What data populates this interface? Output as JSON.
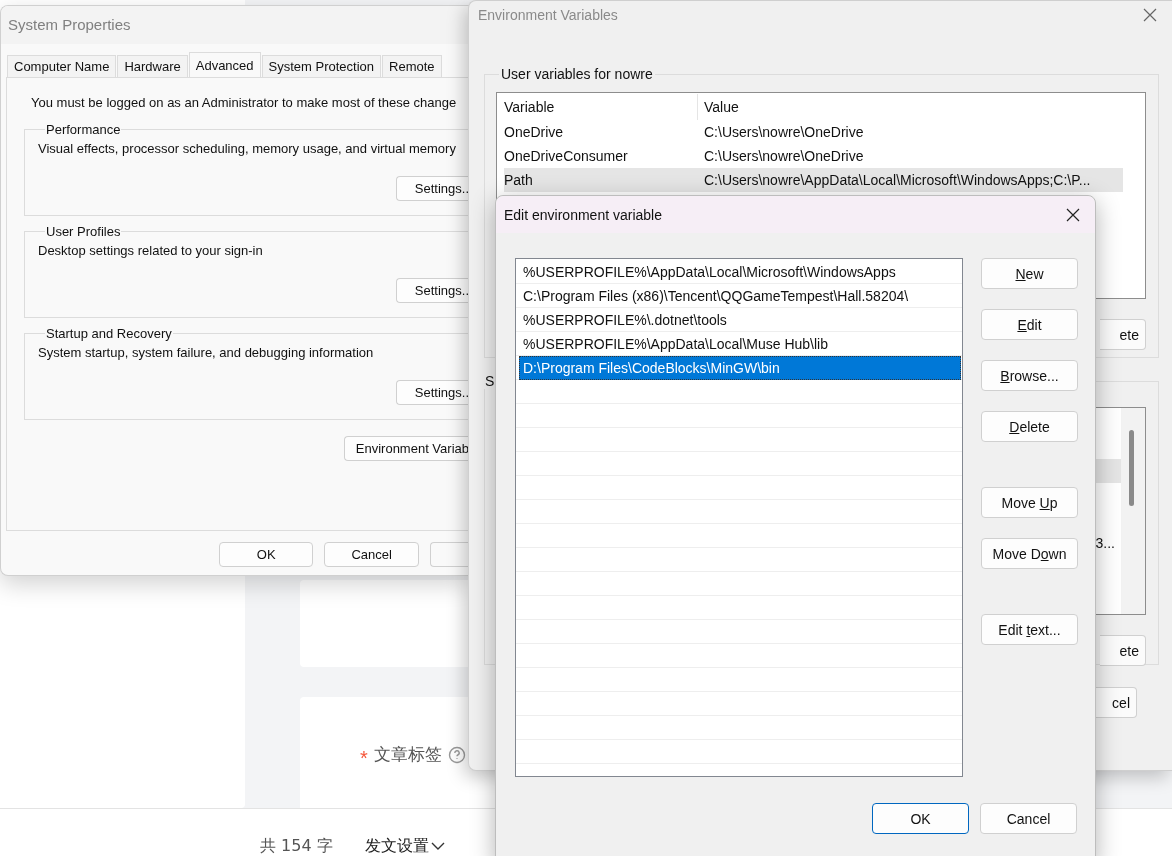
{
  "page": {
    "tag_field": {
      "required_mark": "*",
      "label": "文章标签"
    },
    "char_count": "共 154 字",
    "settings_menu": "发文设置"
  },
  "system_properties": {
    "title": "System Properties",
    "tabs": [
      {
        "label": "Computer Name",
        "selected": false
      },
      {
        "label": "Hardware",
        "selected": false
      },
      {
        "label": "Advanced",
        "selected": true
      },
      {
        "label": "System Protection",
        "selected": false
      },
      {
        "label": "Remote",
        "selected": false
      }
    ],
    "notice": "You must be logged on as an Administrator to make most of these change",
    "groups": [
      {
        "legend": "Performance",
        "description": "Visual effects, processor scheduling, memory usage, and virtual memory",
        "button": "Settings.."
      },
      {
        "legend": "User Profiles",
        "description": "Desktop settings related to your sign-in",
        "button": "Settings.."
      },
      {
        "legend": "Startup and Recovery",
        "description": "System startup, system failure, and debugging information",
        "button": "Settings.."
      }
    ],
    "env_button": "Environment Variab",
    "buttons": [
      "OK",
      "Cancel"
    ]
  },
  "environment_variables": {
    "title": "Environment Variables",
    "user_group": {
      "legend": "User variables for nowre",
      "columns": [
        "Variable",
        "Value"
      ],
      "rows": [
        {
          "variable": "OneDrive",
          "value": "C:\\Users\\nowre\\OneDrive",
          "selected": false
        },
        {
          "variable": "OneDriveConsumer",
          "value": "C:\\Users\\nowre\\OneDrive",
          "selected": false
        },
        {
          "variable": "Path",
          "value": "C:\\Users\\nowre\\AppData\\Local\\Microsoft\\WindowsApps;C:\\P...",
          "selected": true
        }
      ],
      "button_fragment": "ete"
    },
    "system_group": {
      "legend_fragment": "S",
      "row_fragment": "3...",
      "button_fragment": "ete"
    },
    "cancel_fragment": "cel"
  },
  "edit_dialog": {
    "title": "Edit environment variable",
    "entries": [
      {
        "text": "%USERPROFILE%\\AppData\\Local\\Microsoft\\WindowsApps",
        "selected": false
      },
      {
        "text": "C:\\Program Files (x86)\\Tencent\\QQGameTempest\\Hall.58204\\",
        "selected": false
      },
      {
        "text": "%USERPROFILE%\\.dotnet\\tools",
        "selected": false
      },
      {
        "text": "%USERPROFILE%\\AppData\\Local\\Muse Hub\\lib",
        "selected": false
      },
      {
        "text": "D:\\Program Files\\CodeBlocks\\MinGW\\bin",
        "selected": true
      }
    ],
    "side_button_groups": [
      [
        {
          "key": "N",
          "post": "ew"
        },
        {
          "key": "E",
          "post": "dit"
        },
        {
          "key": "B",
          "post": "rowse..."
        },
        {
          "key": "D",
          "post": "elete"
        }
      ],
      [
        {
          "pre": "Move ",
          "key": "U",
          "post": "p"
        },
        {
          "pre": "Move D",
          "key": "o",
          "post": "wn"
        }
      ],
      [
        {
          "pre": "Edit ",
          "key": "t",
          "post": "ext..."
        }
      ]
    ],
    "ok": "OK",
    "cancel": "Cancel"
  }
}
